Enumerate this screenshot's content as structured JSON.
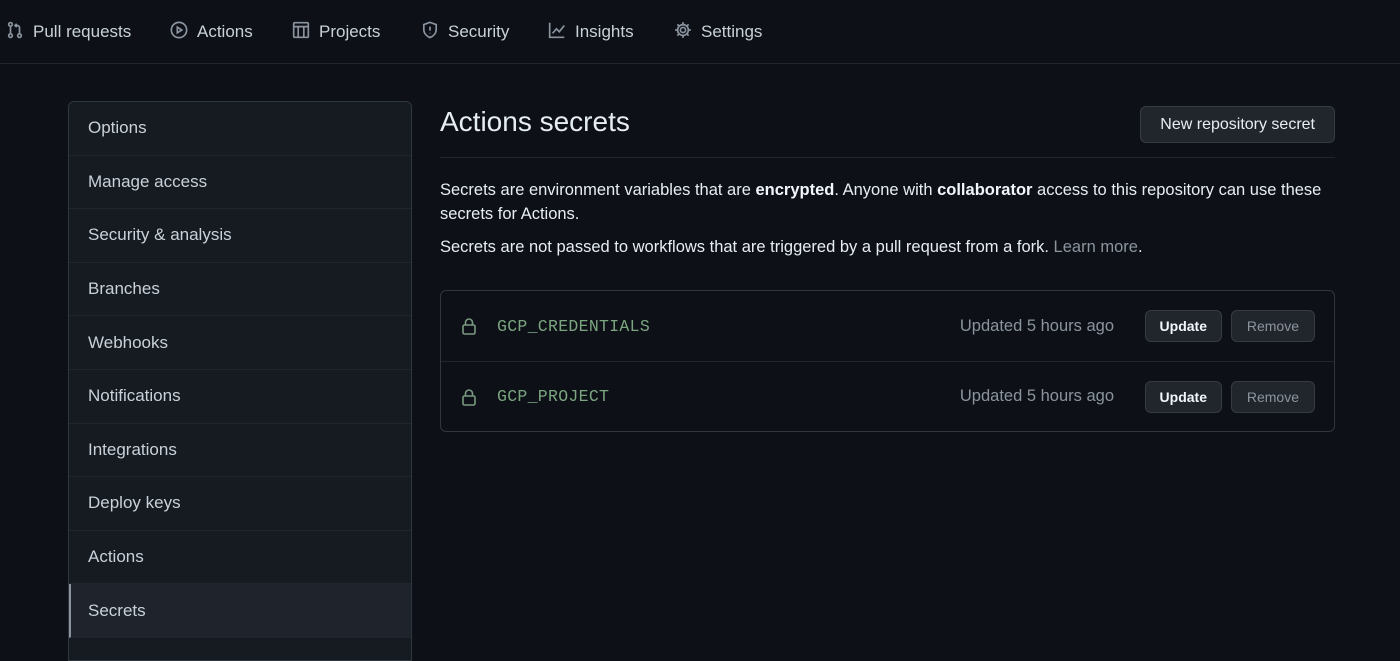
{
  "nav": {
    "tabs": [
      {
        "label": "Pull requests",
        "icon": "git-pull-request-icon"
      },
      {
        "label": "Actions",
        "icon": "play-icon"
      },
      {
        "label": "Projects",
        "icon": "project-icon"
      },
      {
        "label": "Security",
        "icon": "shield-icon"
      },
      {
        "label": "Insights",
        "icon": "graph-icon"
      },
      {
        "label": "Settings",
        "icon": "gear-icon"
      }
    ]
  },
  "sidebar": {
    "items": [
      {
        "label": "Options"
      },
      {
        "label": "Manage access"
      },
      {
        "label": "Security & analysis"
      },
      {
        "label": "Branches"
      },
      {
        "label": "Webhooks"
      },
      {
        "label": "Notifications"
      },
      {
        "label": "Integrations"
      },
      {
        "label": "Deploy keys"
      },
      {
        "label": "Actions"
      },
      {
        "label": "Secrets",
        "selected": true
      }
    ]
  },
  "main": {
    "title": "Actions secrets",
    "new_button": "New repository secret",
    "description": {
      "p1_a": "Secrets are environment variables that are ",
      "p1_b": "encrypted",
      "p1_c": ". Anyone with ",
      "p1_d": "collaborator",
      "p1_e": " access to this repository can use these secrets for Actions.",
      "p2_a": "Secrets are not passed to workflows that are triggered by a pull request from a fork. ",
      "p2_link": "Learn more",
      "p2_end": "."
    },
    "secrets": [
      {
        "name": "GCP_CREDENTIALS",
        "updated": "Updated 5 hours ago",
        "update_label": "Update",
        "remove_label": "Remove"
      },
      {
        "name": "GCP_PROJECT",
        "updated": "Updated 5 hours ago",
        "update_label": "Update",
        "remove_label": "Remove"
      }
    ]
  },
  "colors": {
    "background": "#0d1117",
    "sidebar_bg": "#161b22",
    "border": "#30363d",
    "secret_name": "#7aa57f",
    "muted_text": "#8b949e"
  }
}
